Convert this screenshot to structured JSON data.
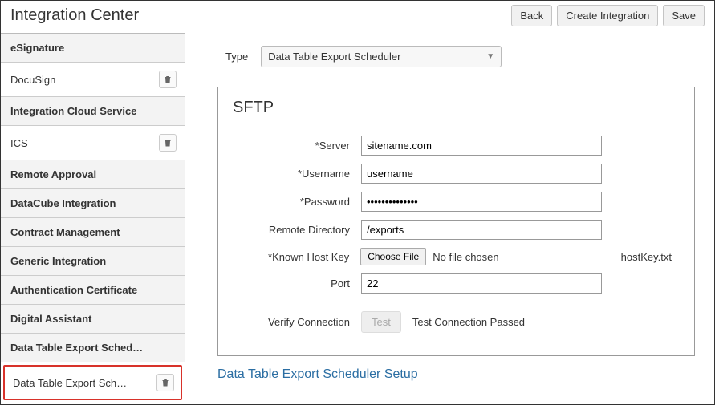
{
  "header": {
    "title": "Integration Center",
    "back": "Back",
    "create": "Create Integration",
    "save": "Save"
  },
  "sidebar": {
    "groups": [
      {
        "label": "eSignature"
      },
      {
        "label": "DocuSign",
        "child": true,
        "trash": true
      },
      {
        "label": "Integration Cloud Service"
      },
      {
        "label": "ICS",
        "child": true,
        "trash": true
      },
      {
        "label": "Remote Approval"
      },
      {
        "label": "DataCube Integration"
      },
      {
        "label": "Contract Management"
      },
      {
        "label": "Generic Integration"
      },
      {
        "label": "Authentication Certificate"
      },
      {
        "label": "Digital Assistant"
      },
      {
        "label": "Data Table Export Sched…"
      }
    ],
    "highlighted": {
      "label": "Data Table Export Sch…"
    }
  },
  "type_field": {
    "label": "Type",
    "value": "Data Table Export Scheduler"
  },
  "sftp": {
    "title": "SFTP",
    "fields": {
      "server_label": "*Server",
      "server_value": "sitename.com",
      "user_label": "*Username",
      "user_value": "username",
      "pass_label": "*Password",
      "pass_value": "••••••••••••••",
      "dir_label": "Remote Directory",
      "dir_value": "/exports",
      "hostkey_label": "*Known Host Key",
      "hostkey_button": "Choose File",
      "hostkey_status": "No file chosen",
      "hostkey_filename": "hostKey.txt",
      "port_label": "Port",
      "port_value": "22",
      "verify_label": "Verify Connection",
      "verify_button": "Test",
      "verify_status": "Test Connection Passed"
    }
  },
  "section_link": "Data Table Export Scheduler Setup"
}
